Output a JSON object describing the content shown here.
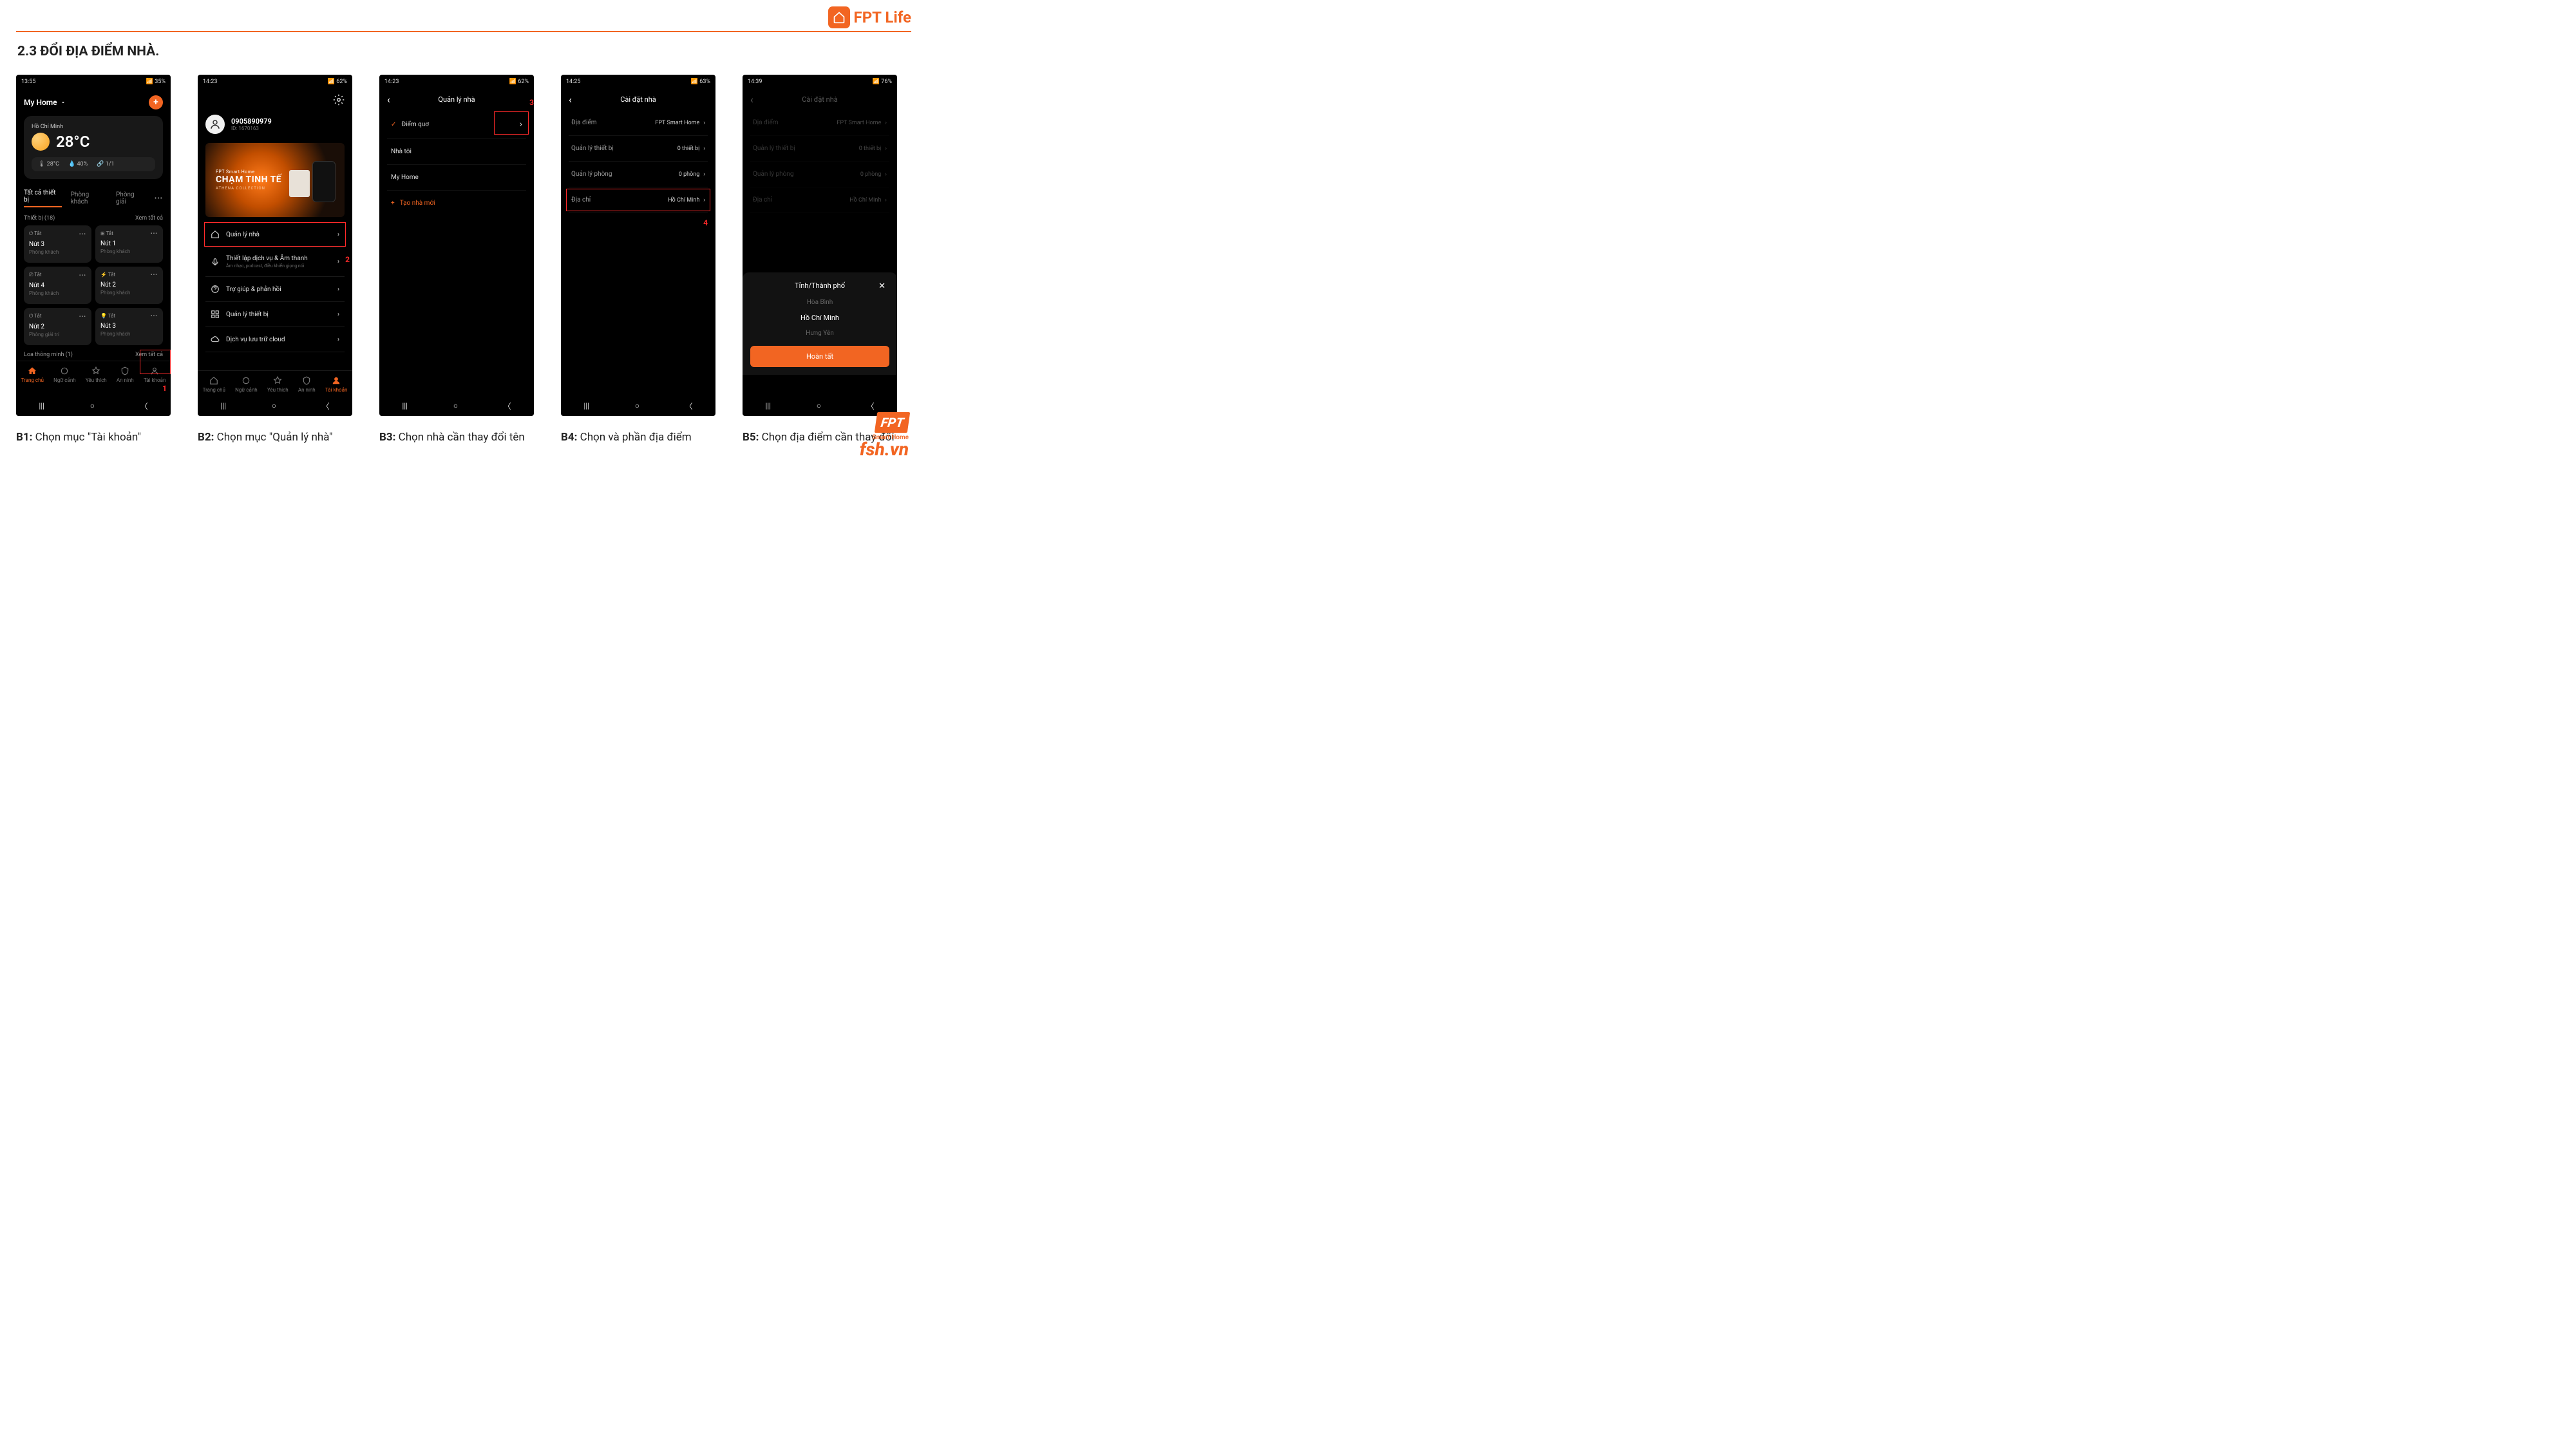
{
  "header": {
    "logo_text": "FPT Life"
  },
  "section_title": "2.3 ĐỔI ĐỊA ĐIỂM NHÀ.",
  "s1": {
    "time": "13:55",
    "battery": "35%",
    "home": "My Home",
    "loc": "Hồ Chí Minh",
    "temp": "28°C",
    "stat_temp": "28°C",
    "stat_humid": "40%",
    "stat_ratio": "1/1",
    "tab_all": "Tất cả thiết bị",
    "tab_living": "Phòng khách",
    "tab_ent": "Phòng giải",
    "sec_devices": "Thiết bị (18)",
    "view_all": "Xem tất cả",
    "off": "Tắt",
    "d1_name": "Nút 3",
    "d1_room": "Phòng khách",
    "d2_name": "Nút 1",
    "d2_room": "Phòng khách",
    "d3_name": "Nút 4",
    "d3_room": "Phòng khách",
    "d4_name": "Nút 2",
    "d4_room": "Phòng khách",
    "d5_name": "Nút 2",
    "d5_room": "Phòng giải trí",
    "d6_name": "Nút 3",
    "d6_room": "Phòng khách",
    "sec_speaker": "Loa thông minh (1)",
    "red1": "1",
    "caption_b": "B1:",
    "caption": "Chọn mục \"Tài khoản\""
  },
  "s2": {
    "time": "14:23",
    "battery": "62%",
    "phone": "0905890979",
    "userid": "ID: 1670163",
    "banner_small": "FPT Smart Home",
    "banner_big": "CHẠM TINH TẾ",
    "banner_sub": "ATHENA COLLECTION",
    "m1": "Quản lý nhà",
    "m2": "Thiết lập dịch vụ & Âm thanh",
    "m2_sub": "Âm nhạc, podcast, điều khiển giọng nói",
    "m3": "Trợ giúp & phản hồi",
    "m4": "Quản lý thiết bị",
    "m5": "Dịch vụ lưu trữ cloud",
    "red2": "2",
    "caption_b": "B2:",
    "caption": "Chọn mục \"Quản lý nhà\""
  },
  "s3": {
    "time": "14:23",
    "battery": "62%",
    "title": "Quản lý nhà",
    "h1": "Điểm quơ",
    "h2": "Nhà tôi",
    "h3": "My Home",
    "create": "Tạo nhà mới",
    "red3": "3",
    "caption_b": "B3:",
    "caption": "Chọn nhà cần thay đổi tên"
  },
  "s4": {
    "time": "14:25",
    "battery": "63%",
    "title": "Cài đặt nhà",
    "r1_l": "Địa điểm",
    "r1_v": "FPT Smart Home",
    "r2_l": "Quản lý thiết bị",
    "r2_v": "0 thiết bị",
    "r3_l": "Quản lý phòng",
    "r3_v": "0 phòng",
    "r4_l": "Địa chỉ",
    "r4_v": "Hồ Chí Minh",
    "red4": "4",
    "caption_b": "B4:",
    "caption": "Chọn và phần địa điểm"
  },
  "s5": {
    "time": "14:39",
    "battery": "76%",
    "title": "Cài đặt nhà",
    "r1_l": "Địa điểm",
    "r1_v": "FPT Smart Home",
    "r2_l": "Quản lý thiết bị",
    "r2_v": "0 thiết bị",
    "r3_l": "Quản lý phòng",
    "r3_v": "0 phòng",
    "r4_l": "Địa chỉ",
    "r4_v": "Hồ Chí Minh",
    "sheet_title": "Tỉnh/Thành phố",
    "opt1": "Hòa Bình",
    "opt2": "Hồ Chí Minh",
    "opt3": "Hưng Yên",
    "done": "Hoàn tất",
    "caption_b": "B5:",
    "caption": "Chọn địa điểm cần thay đổi"
  },
  "tabs": {
    "home": "Trang chủ",
    "scene": "Ngữ cảnh",
    "fav": "Yêu thích",
    "sec": "An ninh",
    "acct": "Tài khoản"
  },
  "footer": {
    "smart_home": "Smart Home",
    "url": "fsh.vn"
  }
}
